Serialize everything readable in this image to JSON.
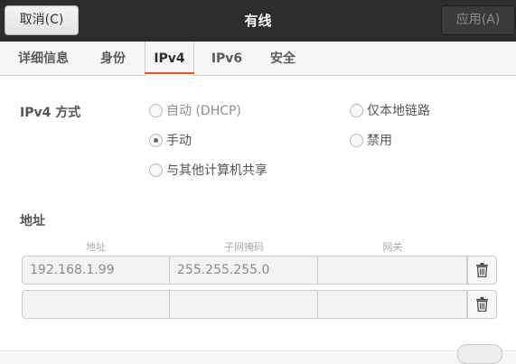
{
  "header": {
    "title": "有线",
    "cancel_label": "取消(C)",
    "apply_label": "应用(A)"
  },
  "tabs": [
    {
      "label": "详细信息",
      "active": false
    },
    {
      "label": "身份",
      "active": false
    },
    {
      "label": "IPv4",
      "active": true
    },
    {
      "label": "IPv6",
      "active": false
    },
    {
      "label": "安全",
      "active": false
    }
  ],
  "ipv4_method": {
    "label": "IPv4 方式",
    "options": [
      {
        "label": "自动 (DHCP)",
        "checked": false
      },
      {
        "label": "仅本地链路",
        "checked": false
      },
      {
        "label": "手动",
        "checked": true
      },
      {
        "label": "禁用",
        "checked": false
      },
      {
        "label": "与其他计算机共享",
        "checked": false
      }
    ]
  },
  "addresses": {
    "label": "地址",
    "columns": [
      "地址",
      "子网掩码",
      "网关"
    ],
    "rows": [
      {
        "address": "192.168.1.99",
        "netmask": "255.255.255.0",
        "gateway": ""
      },
      {
        "address": "",
        "netmask": "",
        "gateway": ""
      }
    ]
  },
  "colors": {
    "titlebar": "#2d2d2d",
    "accent": "#e95420"
  }
}
